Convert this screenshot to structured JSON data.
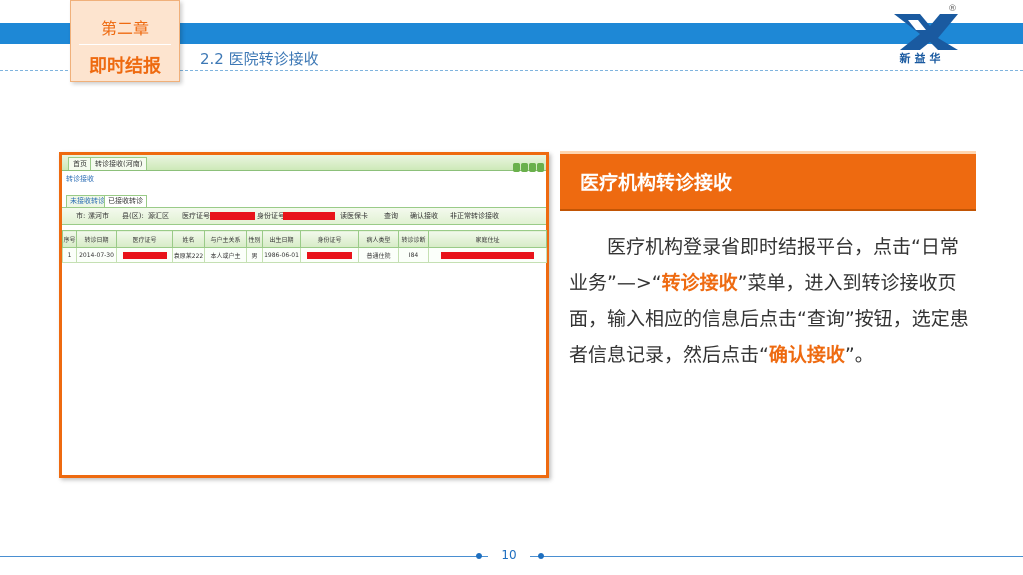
{
  "header": {
    "chapter_label": "第二章",
    "chapter_title": "即时结报",
    "section_title": "2.2 医院转诊接收",
    "logo_text": "新益华",
    "logo_mark": "®"
  },
  "screenshot": {
    "tabs": [
      "首页",
      "转诊接收(河南)"
    ],
    "breadcrumb": "转诊接收",
    "subtabs": [
      "未接收转诊",
      "已接收转诊"
    ],
    "filters": {
      "city_label": "市:",
      "city_value": "漯河市",
      "county_label": "县(区):",
      "county_value": "源汇区",
      "medical_no_label": "医疗证号:",
      "id_no_label": "身份证号:",
      "btn_read_card": "读医保卡",
      "btn_query": "查询",
      "btn_confirm": "确认接收",
      "btn_abnormal": "非正常转诊接收"
    },
    "table": {
      "columns": [
        "序号",
        "转诊日期",
        "医疗证号",
        "姓名",
        "与户主关系",
        "性别",
        "出生日期",
        "身份证号",
        "病人类型",
        "转诊诊断",
        "家庭住址"
      ],
      "rows": [
        {
          "no": "1",
          "date": "2014-07-30",
          "name": "袁原某222",
          "relation": "本人或户主",
          "gender": "男",
          "birth": "1986-06-01",
          "patient_type": "普通住院",
          "diagnosis": "I84"
        }
      ]
    }
  },
  "callout": {
    "title": "医疗机构转诊接收"
  },
  "description": {
    "part1": "医疗机构登录省即时结报平台，点击“日常业务”—>“",
    "hl1": "转诊接收",
    "part2": "”菜单，进入到转诊接收页面，输入相应的信息后点击“查询”按钮，选定患者信息记录，然后点击“",
    "hl2": "确认接收",
    "part3": "”。"
  },
  "footer": {
    "page_number": "10"
  },
  "colors": {
    "accent_orange": "#ee6a10",
    "brand_blue": "#1e88d6",
    "redaction": "#e8141a"
  }
}
